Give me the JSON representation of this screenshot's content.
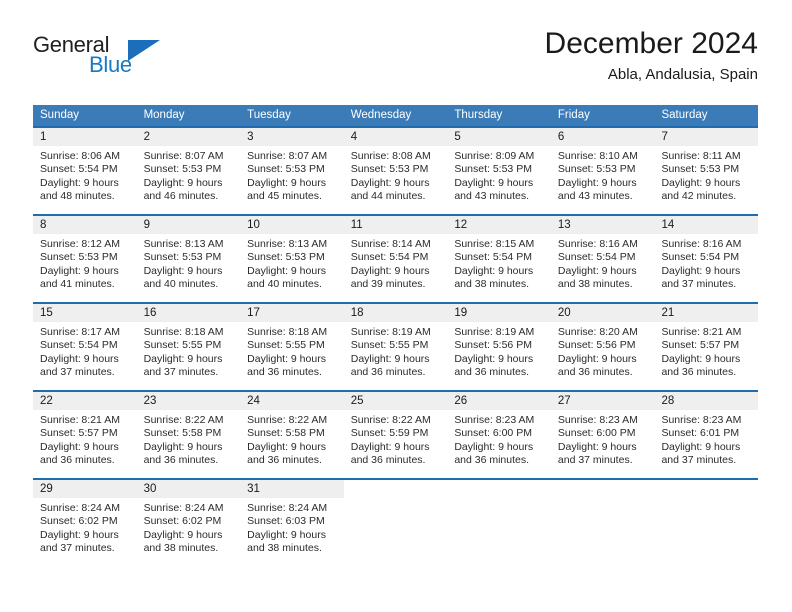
{
  "brand": {
    "name_part1": "General",
    "name_part2": "Blue",
    "accent_color": "#1879c4",
    "triangle_color": "#1b6fba"
  },
  "header": {
    "title": "December 2024",
    "subtitle": "Abla, Andalusia, Spain"
  },
  "calendar": {
    "header_bg": "#3b7cb8",
    "week_separator_color": "#1f6cb0",
    "day_number_bg": "#efefef",
    "weekdays": [
      "Sunday",
      "Monday",
      "Tuesday",
      "Wednesday",
      "Thursday",
      "Friday",
      "Saturday"
    ],
    "weeks": [
      [
        {
          "day": "1",
          "sunrise": "Sunrise: 8:06 AM",
          "sunset": "Sunset: 5:54 PM",
          "daylight1": "Daylight: 9 hours",
          "daylight2": "and 48 minutes."
        },
        {
          "day": "2",
          "sunrise": "Sunrise: 8:07 AM",
          "sunset": "Sunset: 5:53 PM",
          "daylight1": "Daylight: 9 hours",
          "daylight2": "and 46 minutes."
        },
        {
          "day": "3",
          "sunrise": "Sunrise: 8:07 AM",
          "sunset": "Sunset: 5:53 PM",
          "daylight1": "Daylight: 9 hours",
          "daylight2": "and 45 minutes."
        },
        {
          "day": "4",
          "sunrise": "Sunrise: 8:08 AM",
          "sunset": "Sunset: 5:53 PM",
          "daylight1": "Daylight: 9 hours",
          "daylight2": "and 44 minutes."
        },
        {
          "day": "5",
          "sunrise": "Sunrise: 8:09 AM",
          "sunset": "Sunset: 5:53 PM",
          "daylight1": "Daylight: 9 hours",
          "daylight2": "and 43 minutes."
        },
        {
          "day": "6",
          "sunrise": "Sunrise: 8:10 AM",
          "sunset": "Sunset: 5:53 PM",
          "daylight1": "Daylight: 9 hours",
          "daylight2": "and 43 minutes."
        },
        {
          "day": "7",
          "sunrise": "Sunrise: 8:11 AM",
          "sunset": "Sunset: 5:53 PM",
          "daylight1": "Daylight: 9 hours",
          "daylight2": "and 42 minutes."
        }
      ],
      [
        {
          "day": "8",
          "sunrise": "Sunrise: 8:12 AM",
          "sunset": "Sunset: 5:53 PM",
          "daylight1": "Daylight: 9 hours",
          "daylight2": "and 41 minutes."
        },
        {
          "day": "9",
          "sunrise": "Sunrise: 8:13 AM",
          "sunset": "Sunset: 5:53 PM",
          "daylight1": "Daylight: 9 hours",
          "daylight2": "and 40 minutes."
        },
        {
          "day": "10",
          "sunrise": "Sunrise: 8:13 AM",
          "sunset": "Sunset: 5:53 PM",
          "daylight1": "Daylight: 9 hours",
          "daylight2": "and 40 minutes."
        },
        {
          "day": "11",
          "sunrise": "Sunrise: 8:14 AM",
          "sunset": "Sunset: 5:54 PM",
          "daylight1": "Daylight: 9 hours",
          "daylight2": "and 39 minutes."
        },
        {
          "day": "12",
          "sunrise": "Sunrise: 8:15 AM",
          "sunset": "Sunset: 5:54 PM",
          "daylight1": "Daylight: 9 hours",
          "daylight2": "and 38 minutes."
        },
        {
          "day": "13",
          "sunrise": "Sunrise: 8:16 AM",
          "sunset": "Sunset: 5:54 PM",
          "daylight1": "Daylight: 9 hours",
          "daylight2": "and 38 minutes."
        },
        {
          "day": "14",
          "sunrise": "Sunrise: 8:16 AM",
          "sunset": "Sunset: 5:54 PM",
          "daylight1": "Daylight: 9 hours",
          "daylight2": "and 37 minutes."
        }
      ],
      [
        {
          "day": "15",
          "sunrise": "Sunrise: 8:17 AM",
          "sunset": "Sunset: 5:54 PM",
          "daylight1": "Daylight: 9 hours",
          "daylight2": "and 37 minutes."
        },
        {
          "day": "16",
          "sunrise": "Sunrise: 8:18 AM",
          "sunset": "Sunset: 5:55 PM",
          "daylight1": "Daylight: 9 hours",
          "daylight2": "and 37 minutes."
        },
        {
          "day": "17",
          "sunrise": "Sunrise: 8:18 AM",
          "sunset": "Sunset: 5:55 PM",
          "daylight1": "Daylight: 9 hours",
          "daylight2": "and 36 minutes."
        },
        {
          "day": "18",
          "sunrise": "Sunrise: 8:19 AM",
          "sunset": "Sunset: 5:55 PM",
          "daylight1": "Daylight: 9 hours",
          "daylight2": "and 36 minutes."
        },
        {
          "day": "19",
          "sunrise": "Sunrise: 8:19 AM",
          "sunset": "Sunset: 5:56 PM",
          "daylight1": "Daylight: 9 hours",
          "daylight2": "and 36 minutes."
        },
        {
          "day": "20",
          "sunrise": "Sunrise: 8:20 AM",
          "sunset": "Sunset: 5:56 PM",
          "daylight1": "Daylight: 9 hours",
          "daylight2": "and 36 minutes."
        },
        {
          "day": "21",
          "sunrise": "Sunrise: 8:21 AM",
          "sunset": "Sunset: 5:57 PM",
          "daylight1": "Daylight: 9 hours",
          "daylight2": "and 36 minutes."
        }
      ],
      [
        {
          "day": "22",
          "sunrise": "Sunrise: 8:21 AM",
          "sunset": "Sunset: 5:57 PM",
          "daylight1": "Daylight: 9 hours",
          "daylight2": "and 36 minutes."
        },
        {
          "day": "23",
          "sunrise": "Sunrise: 8:22 AM",
          "sunset": "Sunset: 5:58 PM",
          "daylight1": "Daylight: 9 hours",
          "daylight2": "and 36 minutes."
        },
        {
          "day": "24",
          "sunrise": "Sunrise: 8:22 AM",
          "sunset": "Sunset: 5:58 PM",
          "daylight1": "Daylight: 9 hours",
          "daylight2": "and 36 minutes."
        },
        {
          "day": "25",
          "sunrise": "Sunrise: 8:22 AM",
          "sunset": "Sunset: 5:59 PM",
          "daylight1": "Daylight: 9 hours",
          "daylight2": "and 36 minutes."
        },
        {
          "day": "26",
          "sunrise": "Sunrise: 8:23 AM",
          "sunset": "Sunset: 6:00 PM",
          "daylight1": "Daylight: 9 hours",
          "daylight2": "and 36 minutes."
        },
        {
          "day": "27",
          "sunrise": "Sunrise: 8:23 AM",
          "sunset": "Sunset: 6:00 PM",
          "daylight1": "Daylight: 9 hours",
          "daylight2": "and 37 minutes."
        },
        {
          "day": "28",
          "sunrise": "Sunrise: 8:23 AM",
          "sunset": "Sunset: 6:01 PM",
          "daylight1": "Daylight: 9 hours",
          "daylight2": "and 37 minutes."
        }
      ],
      [
        {
          "day": "29",
          "sunrise": "Sunrise: 8:24 AM",
          "sunset": "Sunset: 6:02 PM",
          "daylight1": "Daylight: 9 hours",
          "daylight2": "and 37 minutes."
        },
        {
          "day": "30",
          "sunrise": "Sunrise: 8:24 AM",
          "sunset": "Sunset: 6:02 PM",
          "daylight1": "Daylight: 9 hours",
          "daylight2": "and 38 minutes."
        },
        {
          "day": "31",
          "sunrise": "Sunrise: 8:24 AM",
          "sunset": "Sunset: 6:03 PM",
          "daylight1": "Daylight: 9 hours",
          "daylight2": "and 38 minutes."
        },
        {
          "day": "",
          "sunrise": "",
          "sunset": "",
          "daylight1": "",
          "daylight2": ""
        },
        {
          "day": "",
          "sunrise": "",
          "sunset": "",
          "daylight1": "",
          "daylight2": ""
        },
        {
          "day": "",
          "sunrise": "",
          "sunset": "",
          "daylight1": "",
          "daylight2": ""
        },
        {
          "day": "",
          "sunrise": "",
          "sunset": "",
          "daylight1": "",
          "daylight2": ""
        }
      ]
    ]
  }
}
